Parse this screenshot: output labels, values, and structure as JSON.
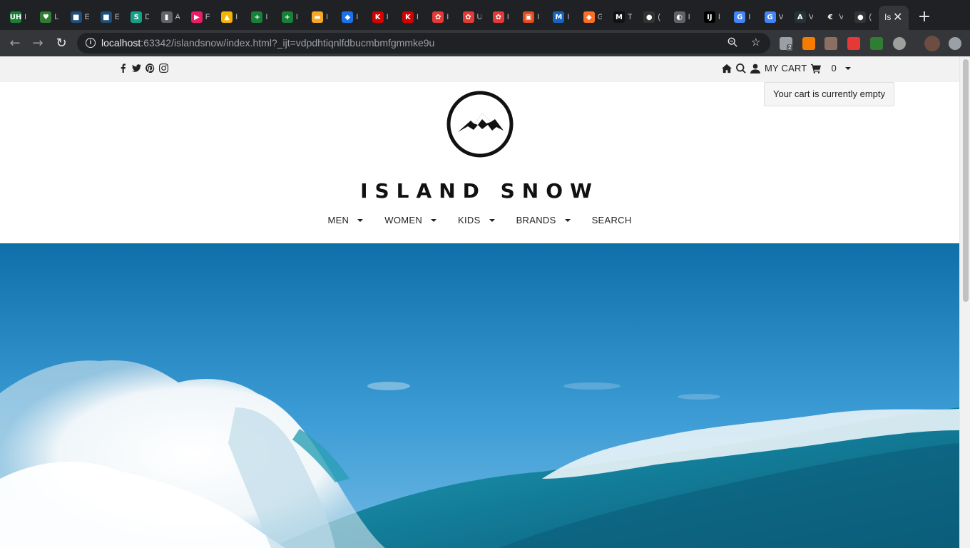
{
  "browser": {
    "tabs": [
      {
        "abbr": "UH",
        "color": "#1a7f37",
        "label": "I"
      },
      {
        "abbr": "♥",
        "color": "#2e7d32",
        "label": "L"
      },
      {
        "abbr": "■",
        "color": "#1e4e79",
        "label": "E"
      },
      {
        "abbr": "■",
        "color": "#1e4e79",
        "label": "E"
      },
      {
        "abbr": "S",
        "color": "#16a085",
        "label": "D"
      },
      {
        "abbr": "▮",
        "color": "#5f6368",
        "label": "A"
      },
      {
        "abbr": "▶",
        "color": "#e91e63",
        "label": "F"
      },
      {
        "abbr": "▲",
        "color": "#f4b400",
        "label": "I"
      },
      {
        "abbr": "+",
        "color": "#188038",
        "label": "I"
      },
      {
        "abbr": "+",
        "color": "#188038",
        "label": "I"
      },
      {
        "abbr": "▬",
        "color": "#f9a825",
        "label": "I"
      },
      {
        "abbr": "◆",
        "color": "#1a73e8",
        "label": "I"
      },
      {
        "abbr": "K",
        "color": "#d50000",
        "label": "I"
      },
      {
        "abbr": "K",
        "color": "#d50000",
        "label": "I"
      },
      {
        "abbr": "✿",
        "color": "#e53935",
        "label": "I"
      },
      {
        "abbr": "✿",
        "color": "#e53935",
        "label": "U"
      },
      {
        "abbr": "✿",
        "color": "#e53935",
        "label": "I"
      },
      {
        "abbr": "▣",
        "color": "#e64a19",
        "label": "I"
      },
      {
        "abbr": "M",
        "color": "#1565c0",
        "label": "I"
      },
      {
        "abbr": "◆",
        "color": "#fc6d26",
        "label": "G"
      },
      {
        "abbr": "M",
        "color": "#111111",
        "label": "T"
      },
      {
        "abbr": "●",
        "color": "#333333",
        "label": "("
      },
      {
        "abbr": "◐",
        "color": "#5f6368",
        "label": "I"
      },
      {
        "abbr": "IJ",
        "color": "#000000",
        "label": "I"
      },
      {
        "abbr": "G",
        "color": "#4285f4",
        "label": "I"
      },
      {
        "abbr": "G",
        "color": "#4285f4",
        "label": "V"
      },
      {
        "abbr": "A",
        "color": "#263238",
        "label": "V"
      },
      {
        "abbr": "€",
        "color": "#212121",
        "label": "V"
      },
      {
        "abbr": "●",
        "color": "#333333",
        "label": "("
      }
    ],
    "active_tab": {
      "label": "Is",
      "close": "✕"
    },
    "new_tab": "+",
    "url_host": "localhost",
    "url_rest": ":63342/islandsnow/index.html?_ijt=vdpdhtiqnlfdbucmbmfgmmke9u",
    "ext_badge": "2"
  },
  "site": {
    "social_icons": [
      "facebook-icon",
      "twitter-icon",
      "pinterest-icon",
      "instagram-icon"
    ],
    "utility": {
      "cart_label": "MY CART",
      "cart_count": "0"
    },
    "cart_popup": "Your cart is currently empty",
    "brand_name": "ISLAND SNOW",
    "nav": [
      {
        "label": "MEN",
        "dropdown": true
      },
      {
        "label": "WOMEN",
        "dropdown": true
      },
      {
        "label": "KIDS",
        "dropdown": true
      },
      {
        "label": "BRANDS",
        "dropdown": true
      },
      {
        "label": "SEARCH",
        "dropdown": false
      }
    ]
  }
}
